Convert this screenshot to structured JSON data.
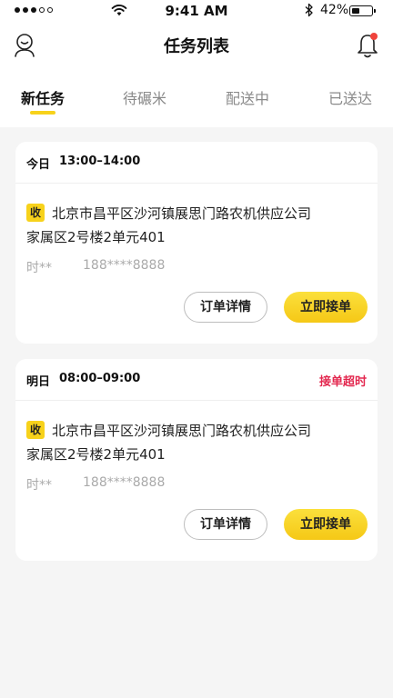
{
  "status_bar": {
    "time": "9:41 AM",
    "battery_percent": "42%",
    "battery_level": 0.42
  },
  "navbar": {
    "title": "任务列表"
  },
  "tabs": [
    {
      "label": "新任务",
      "active": true
    },
    {
      "label": "待碾米",
      "active": false
    },
    {
      "label": "配送中",
      "active": false
    },
    {
      "label": "已送达",
      "active": false
    }
  ],
  "orders": [
    {
      "date": "今日",
      "time_range": "13:00–14:00",
      "status": "",
      "tag": "收",
      "address_line1": "北京市昌平区沙河镇展思门路农机供应公司",
      "address_line2": "家属区2号楼2单元401",
      "contact_name": "时**",
      "contact_phone": "188****8888",
      "detail_label": "订单详情",
      "accept_label": "立即接单"
    },
    {
      "date": "明日",
      "time_range": "08:00–09:00",
      "status": "接单超时",
      "tag": "收",
      "address_line1": "北京市昌平区沙河镇展思门路农机供应公司",
      "address_line2": "家属区2号楼2单元401",
      "contact_name": "时**",
      "contact_phone": "188****8888",
      "detail_label": "订单详情",
      "accept_label": "立即接单"
    }
  ],
  "colors": {
    "accent": "#f7d21b",
    "alert": "#e3284f",
    "badge": "#f0433c",
    "background": "#f5f5f5"
  },
  "icons": {
    "profile": "user-profile-icon",
    "notifications": "bell-icon",
    "wifi": "wifi-icon",
    "bluetooth": "bluetooth-icon"
  }
}
